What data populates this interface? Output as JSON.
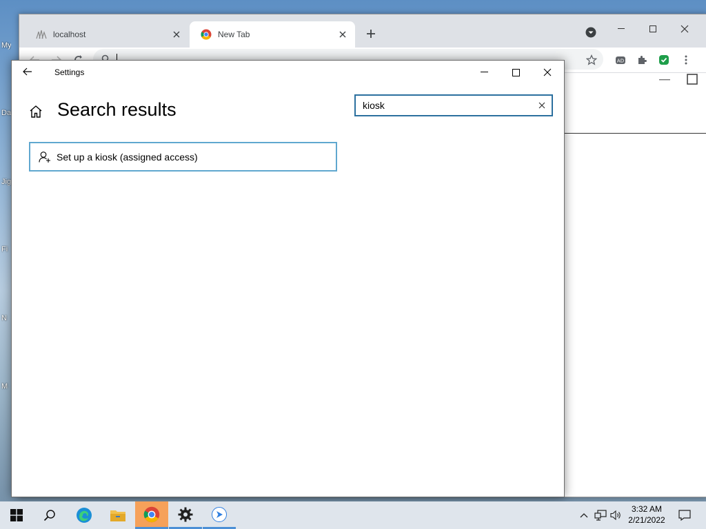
{
  "desktop": {
    "icon_labels": [
      "My",
      "Da",
      "Jig",
      "Fi",
      "N",
      "M"
    ]
  },
  "browser": {
    "tabs": [
      {
        "label": "localhost",
        "active": false
      },
      {
        "label": "New Tab",
        "active": true
      }
    ],
    "address_value": ""
  },
  "settings": {
    "window_title": "Settings",
    "heading": "Search results",
    "search": {
      "value": "kiosk"
    },
    "results": [
      {
        "label": "Set up a kiosk (assigned access)",
        "icon": "user-add-icon"
      }
    ]
  },
  "taskbar": {
    "apps": [
      "windows-start",
      "search",
      "edge",
      "file-explorer",
      "chrome",
      "settings",
      "media"
    ],
    "time": "3:32 AM",
    "date": "2/21/2022"
  },
  "colors": {
    "accent": "#2a6f9e",
    "result_border": "#5fa7cf",
    "taskbar_active": "#f6a15a"
  }
}
